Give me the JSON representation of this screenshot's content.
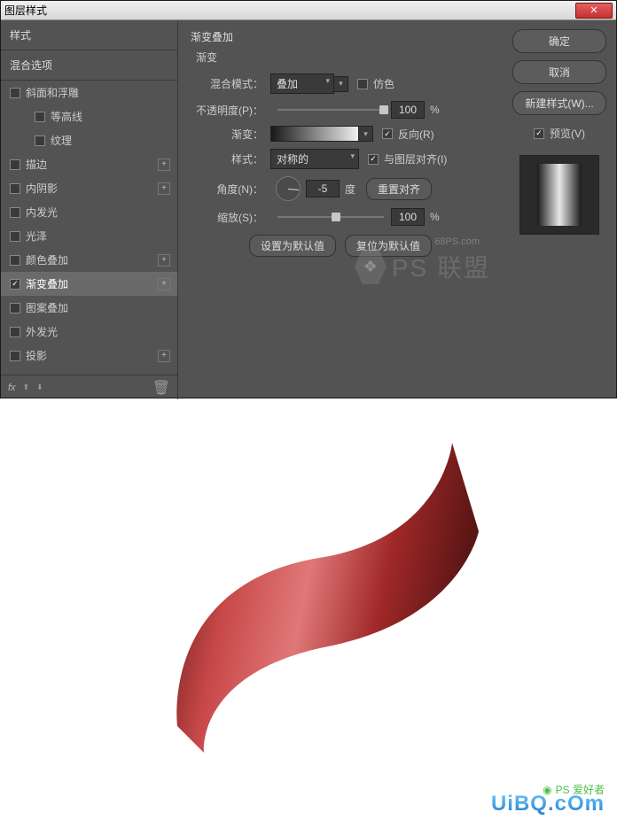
{
  "titlebar": {
    "title": "图层样式"
  },
  "leftPanel": {
    "header": "样式",
    "blendOptions": "混合选项",
    "items": [
      {
        "label": "斜面和浮雕",
        "checked": false,
        "plus": false
      },
      {
        "label": "等高线",
        "sub": true
      },
      {
        "label": "纹理",
        "sub": true
      },
      {
        "label": "描边",
        "checked": false,
        "plus": true
      },
      {
        "label": "内阴影",
        "checked": false,
        "plus": true
      },
      {
        "label": "内发光",
        "checked": false
      },
      {
        "label": "光泽",
        "checked": false
      },
      {
        "label": "颜色叠加",
        "checked": false,
        "plus": true
      },
      {
        "label": "渐变叠加",
        "checked": true,
        "plus": true,
        "selected": true
      },
      {
        "label": "图案叠加",
        "checked": false
      },
      {
        "label": "外发光",
        "checked": false
      },
      {
        "label": "投影",
        "checked": false,
        "plus": true
      }
    ],
    "fx": "fx"
  },
  "center": {
    "title": "渐变叠加",
    "sub": "渐变",
    "blendModeLabel": "混合模式：",
    "blendMode": "叠加",
    "dither": "仿色",
    "opacityLabel": "不透明度(P)：",
    "opacityValue": "100",
    "percent": "%",
    "gradientLabel": "渐变：",
    "reverse": "反向(R)",
    "styleLabel": "样式：",
    "styleValue": "对称的",
    "alignLayer": "与图层对齐(I)",
    "angleLabel": "角度(N)：",
    "angleValue": "-5",
    "degree": "度",
    "resetAlign": "重置对齐",
    "scaleLabel": "缩放(S)：",
    "scaleValue": "100",
    "setDefault": "设置为默认值",
    "resetDefault": "复位为默认值"
  },
  "right": {
    "ok": "确定",
    "cancel": "取消",
    "newStyle": "新建样式(W)...",
    "preview": "预览(V)"
  },
  "watermark": {
    "url": "68PS.com",
    "text": "PS 联盟",
    "bottomText": "PS 爱好者",
    "bottomUrl": "UiBQ.cOm"
  }
}
